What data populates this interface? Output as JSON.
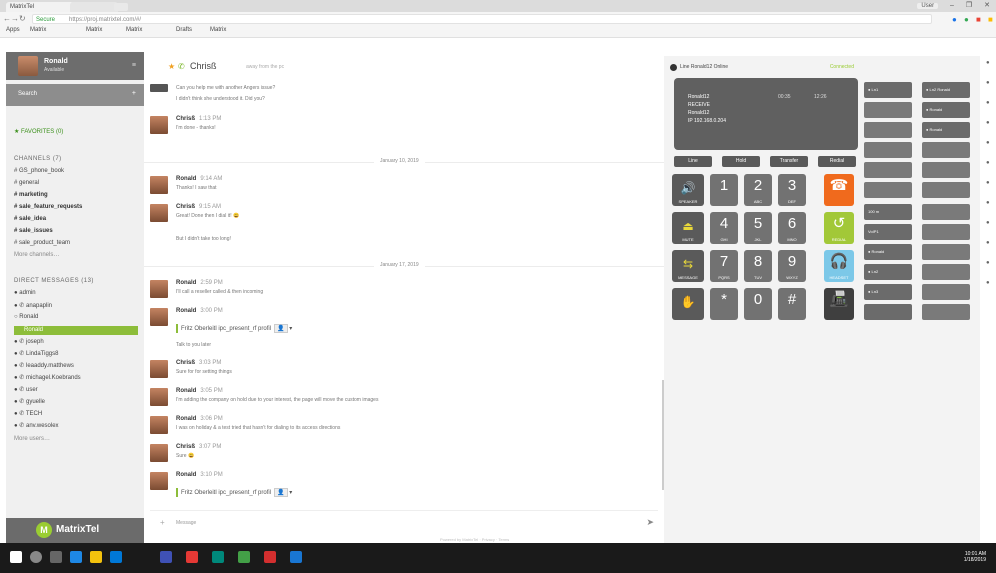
{
  "browser": {
    "tabs": [
      "MatrixTel",
      ""
    ],
    "window_controls": {
      "user": "User",
      "min": "–",
      "max": "❐",
      "close": "✕"
    },
    "nav": {
      "back": "←",
      "forward": "→",
      "reload": "↻",
      "home": "⌂"
    },
    "url": "https://proj.matrixtel.com/#/",
    "secure_label": "Secure",
    "bookmarks": [
      "Apps",
      "Matrix",
      "Matrix",
      "Matrix",
      "Drafts",
      "Matrix"
    ]
  },
  "sidebar": {
    "user": {
      "name": "Ronald",
      "status": "Available"
    },
    "menu_icon": "≡",
    "search_label": "Search",
    "add_icon": "+",
    "favorites_header": "★ FAVORITES (0)",
    "channels_header": "CHANNELS (7)",
    "channels": [
      "# GS_phone_book",
      "# general",
      "# marketing",
      "# sale_feature_requests",
      "# sale_idea",
      "# sale_issues",
      "# sale_product_team"
    ],
    "more_channels": "More channels…",
    "dm_header": "DIRECT MESSAGES (13)",
    "dms": [
      "● admin",
      "● ✆ anapaplin",
      "○ Ronald",
      "Ronald",
      "● ✆ joseph",
      "● ✆ LindaTiggs8",
      "● ✆ leaaddy.matthews",
      "● ✆ michagel.Koebrands",
      "● ✆ user",
      "● ✆ gyuelle",
      "● ✆ TECH",
      "● ✆ anv.wesolex"
    ],
    "more_dms": "More users…",
    "logo_letter": "M",
    "logo_text": "MatrixTel"
  },
  "chat": {
    "star": "★",
    "phone_icon": "✆",
    "room_name": "Chrisß",
    "room_sub": "away from the pc",
    "dates": [
      "January 10, 2019",
      "January 17, 2019"
    ],
    "messages": [
      {
        "author": "",
        "time": "",
        "text": "Can you help me with another Angers issue?"
      },
      {
        "author": "",
        "time": "",
        "text": "I didn't think she understood it. Did you?"
      },
      {
        "author": "Chrisß",
        "time": "1:13 PM",
        "text": "I'm done - thanks!"
      },
      {
        "author": "Ronald",
        "time": "9:14 AM",
        "text": "Thanks! I saw that"
      },
      {
        "author": "Chrisß",
        "time": "9:15 AM",
        "text": "Great! Done then I dial it! 😀"
      },
      {
        "author": "",
        "time": "",
        "text": "But I didn't take too long!"
      },
      {
        "author": "Ronald",
        "time": "2:59 PM",
        "text": "I'll call a reseller called & then incoming"
      },
      {
        "author": "Ronald",
        "time": "3:00 PM",
        "text": ""
      },
      {
        "author": "",
        "time": "",
        "text": "Talk to you later"
      },
      {
        "author": "Chrisß",
        "time": "3:03 PM",
        "text": "Sure for for setting things"
      },
      {
        "author": "Ronald",
        "time": "3:05 PM",
        "text": "I'm adding the company on hold due to your interest, the page will move the custom images"
      },
      {
        "author": "Ronald",
        "time": "3:06 PM",
        "text": "I was on holiday & a test tried that hasn't for dialing to its access directions"
      },
      {
        "author": "Chrisß",
        "time": "3:07 PM",
        "text": "Sure 😀"
      },
      {
        "author": "Ronald",
        "time": "3:10 PM",
        "text": ""
      }
    ],
    "quotes": [
      "Fritz Oberleitl  ipc_present_rf  profil",
      "Fritz Oberleitl  ipc_present_rf  profil"
    ],
    "composer_placeholder": "Message",
    "send_icon": "➤",
    "attach_icon": "+",
    "footer": "Powered by MatrixTel  ·  Privacy  ·  Terms"
  },
  "phone": {
    "title": "Line Ronald12 Online",
    "state": "Connected",
    "screen_lines": [
      "Ronald12",
      "RECEIVE",
      "Ronald12",
      "IP  192.168.0.204"
    ],
    "screen_timer": [
      "00:35",
      "12:26"
    ],
    "softkeys": [
      "Line",
      "Hold",
      "Transfer",
      "Redial"
    ],
    "keys": [
      {
        "d": "1",
        "s": ""
      },
      {
        "d": "2",
        "s": "ABC"
      },
      {
        "d": "3",
        "s": "DEF"
      },
      {
        "d": "4",
        "s": "GHI"
      },
      {
        "d": "5",
        "s": "JKL"
      },
      {
        "d": "6",
        "s": "MNO"
      },
      {
        "d": "7",
        "s": "PQRS"
      },
      {
        "d": "8",
        "s": "TUV"
      },
      {
        "d": "9",
        "s": "WXYZ"
      },
      {
        "d": "*",
        "s": ""
      },
      {
        "d": "0",
        "s": ""
      },
      {
        "d": "#",
        "s": ""
      }
    ],
    "side_keys": [
      {
        "i": "🔊",
        "s": "SPEAKER"
      },
      {
        "i": "⏏",
        "s": "MUTE"
      },
      {
        "i": "⇆",
        "s": "MESSAGE"
      },
      {
        "i": "✋",
        "s": ""
      }
    ],
    "action_keys": [
      {
        "i": "☎",
        "s": ""
      },
      {
        "i": "↺",
        "s": "REDIAL"
      },
      {
        "i": "🎧",
        "s": "HEADSET"
      },
      {
        "i": "📠",
        "s": ""
      }
    ],
    "blf_left": [
      "● Ln1",
      "",
      "",
      "",
      "",
      "",
      "",
      "",
      "",
      "",
      "",
      ""
    ],
    "blf_mid": [
      "● Ronald",
      "● Ronald",
      "● Ronald",
      "",
      "",
      "",
      "",
      "100 m",
      "VoIP1",
      "● Ronald",
      "● Ln2",
      "● Ln3"
    ],
    "blf_right": [
      "● Ln2 Ronald",
      "● Ronald",
      "● Ronald",
      "",
      "",
      "",
      "",
      "",
      "",
      "",
      "",
      ""
    ]
  },
  "taskbar": {
    "clock": [
      "10:01 AM",
      "1/18/2019"
    ]
  },
  "colors": {
    "accent": "#8dbd3a",
    "sidebar": "#6d6d6d",
    "phone_dark": "#606060",
    "orange": "#f06a1d",
    "blue": "#7cc8e8"
  }
}
